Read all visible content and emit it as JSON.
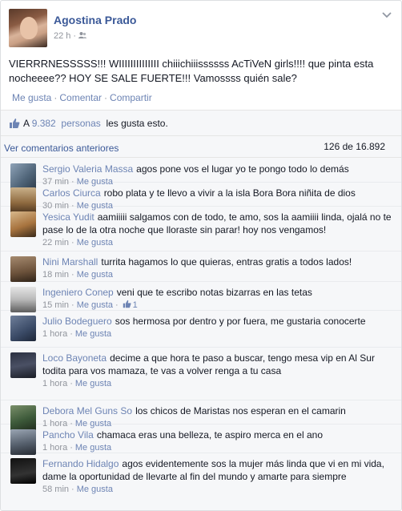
{
  "post": {
    "author": "Agostina Prado",
    "time": "22 h",
    "text": "VIERRRNESSSSS!!! WIIIIIIIIIIIIII chiiichiiissssss AcTiVeN girls!!!! que pinta esta nocheeee?? HOY SE SALE FUERTE!!! Vamossss quién sale?",
    "actions": {
      "like": "Me gusta",
      "comment": "Comentar",
      "share": "Compartir"
    },
    "likes": {
      "prefix": "A",
      "count": "9.382",
      "people": "personas",
      "suffix": "les gusta esto."
    },
    "previous_comments_label": "Ver comentarios anteriores",
    "comment_counter": "126 de 16.892"
  },
  "comments": [
    {
      "name": "Sergio Valeria Massa",
      "text": "agos pone vos el lugar yo te pongo todo lo demás",
      "time": "37 min",
      "like": "Me gusta",
      "likes": ""
    },
    {
      "name": "Carlos Ciurca",
      "text": "robo plata y te llevo a vivir a la isla Bora Bora niñita de dios",
      "time": "30 min",
      "like": "Me gusta",
      "likes": ""
    },
    {
      "name": "Yesica Yudit",
      "text": "aamiiiii salgamos con de todo, te amo, sos la aamiiii linda, ojalá no te pase lo de la otra noche que lloraste sin parar! hoy nos vengamos!",
      "time": "22 min",
      "like": "Me gusta",
      "likes": ""
    },
    {
      "name": "Nini Marshall",
      "text": "turrita hagamos lo que quieras, entras gratis a todos lados!",
      "time": "18 min",
      "like": "Me gusta",
      "likes": ""
    },
    {
      "name": "Ingeniero Conep",
      "text": "veni que te escribo notas bizarras en las tetas",
      "time": "15 min",
      "like": "Me gusta",
      "likes": "1"
    },
    {
      "name": "Julio Bodeguero",
      "text": "sos hermosa por dentro y por fuera, me gustaria conocerte",
      "time": "1 hora",
      "like": "Me gusta",
      "likes": ""
    },
    {
      "name": "Loco Bayoneta",
      "text": "decime a que hora te paso a buscar, tengo mesa vip en Al Sur todita para vos mamaza, te vas a volver renga a tu casa",
      "time": "1 hora",
      "like": "Me gusta",
      "likes": ""
    },
    {
      "name": "Debora Mel Guns So",
      "text": "los chicos de Maristas nos esperan en el camarin",
      "time": "1 hora",
      "like": "Me gusta",
      "likes": ""
    },
    {
      "name": "Pancho Vila",
      "text": "chamaca eras una belleza, te aspiro merca en el ano",
      "time": "1 hora",
      "like": "Me gusta",
      "likes": ""
    },
    {
      "name": "Fernando Hidalgo",
      "text": "agos evidentemente sos la mujer más linda que vi en mi vida, dame la oportunidad de llevarte al fin del mundo y amarte para siempre",
      "time": "58 min",
      "like": "Me gusta",
      "likes": ""
    }
  ],
  "colors": {
    "link": "#3b5998",
    "name": "#6d84b4",
    "meta": "#90949c",
    "feedback_bg": "#f6f7f9"
  },
  "icons": {
    "friends": "friends-icon",
    "chevron": "chevron-down-icon",
    "thumb": "thumbs-up-icon"
  }
}
